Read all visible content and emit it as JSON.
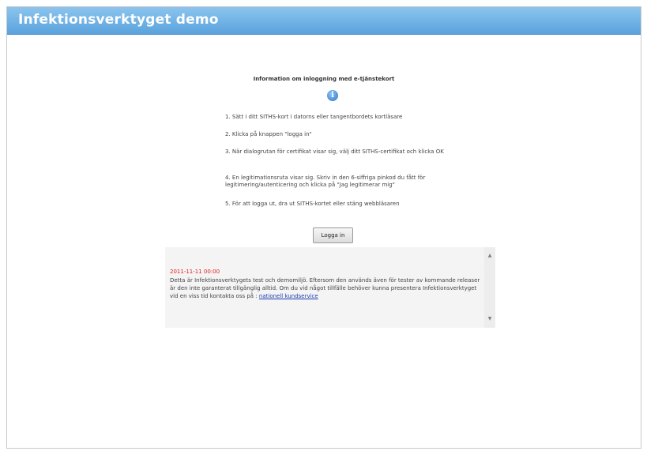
{
  "header": {
    "title": "Infektionsverktyget demo"
  },
  "info": {
    "title": "Information om inloggning med e-tjänstekort",
    "icon": "info-icon",
    "icon_glyph": "i",
    "steps": [
      "1. Sätt i ditt SITHS-kort i datorns eller tangentbordets kortläsare",
      "2. Klicka på knappen \"logga in\"",
      "3. När dialogrutan för certifikat visar sig, välj ditt SITHS-certifikat och klicka OK",
      "4. En legitimationsruta visar sig. Skriv in den 6-siffriga pinkod du fått för legitimering/autenticering och klicka på \"Jag legitimerar mig\"",
      "5. För att logga ut, dra ut SITHS-kortet eller stäng webbläsaren"
    ]
  },
  "login": {
    "button_label": "Logga in"
  },
  "news": {
    "date": "2011-11-11 00:00",
    "text": "Detta är Infektionsverktygets test och demomiljö. Eftersom den används även för tester av kommande releaser är den inte garanterat tillgänglig alltid. Om du vid något tillfälle behöver kunna presentera Infektionsverktyget vid en viss tid kontakta oss på :",
    "link_text": "nationell kundservice",
    "scroll_up_icon": "▲",
    "scroll_down_icon": "▼"
  },
  "colors": {
    "header_start": "#8cc4ee",
    "header_end": "#5aa3dd",
    "date_red": "#e02020",
    "link_blue": "#1a3fb0"
  }
}
